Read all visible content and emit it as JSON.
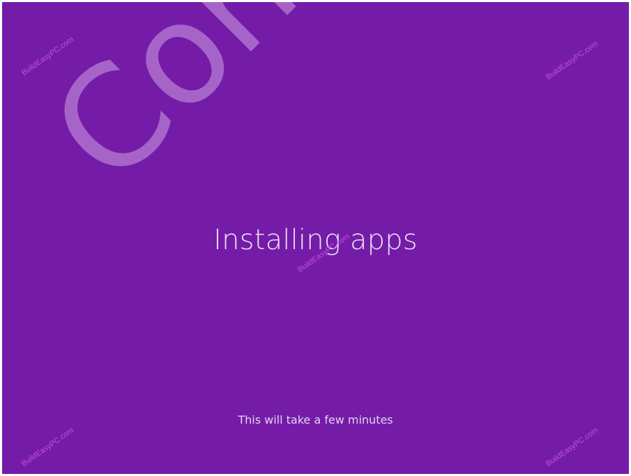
{
  "screen": {
    "background_color": "#741ca8",
    "title": "Installing apps",
    "subtitle": "This will take a few minutes"
  },
  "watermarks": {
    "confidential": "Confidential",
    "site": "BuildEasyPC.com"
  }
}
